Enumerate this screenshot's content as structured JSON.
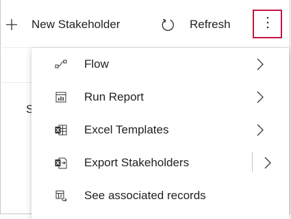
{
  "command_bar": {
    "new_label": "New Stakeholder",
    "refresh_label": "Refresh",
    "more_icon": "more-vertical-icon",
    "highlight_color": "#c4133f"
  },
  "background": {
    "partial_text": "S"
  },
  "menu": {
    "items": [
      {
        "label": "Flow",
        "icon": "flow-icon",
        "has_submenu": true
      },
      {
        "label": "Run Report",
        "icon": "report-icon",
        "has_submenu": true
      },
      {
        "label": "Excel Templates",
        "icon": "excel-template-icon",
        "has_submenu": true
      },
      {
        "label": "Export Stakeholders",
        "icon": "excel-export-icon",
        "has_submenu": true,
        "split_button": true
      },
      {
        "label": "See associated records",
        "icon": "associated-records-icon",
        "has_submenu": false
      }
    ]
  }
}
